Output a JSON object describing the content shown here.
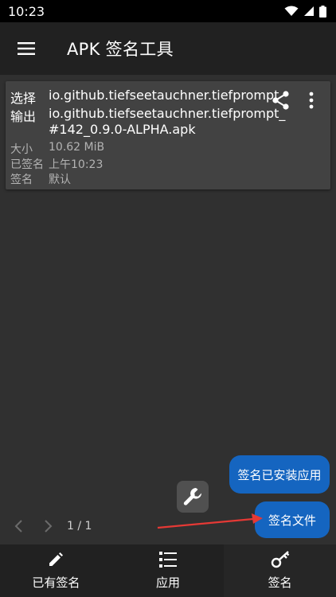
{
  "status_bar": {
    "time": "10:23"
  },
  "app_bar": {
    "title": "APK 签名工具"
  },
  "card": {
    "select_label": "选择",
    "select_value": "io.github.tiefseetauchner.tiefprompt",
    "output_label": "输出",
    "output_value_line1": "io.github.tiefseetauchner.tiefprompt_",
    "output_value_line2": "#142_0.9.0-ALPHA.apk",
    "size_label": "大小",
    "size_value": "10.62 MiB",
    "signed_label": "已签名",
    "signed_value": "上午10:23",
    "signature_label": "签名",
    "signature_value": "默认"
  },
  "fab": {
    "sign_installed": "签名已安装应用",
    "sign_file": "签名文件"
  },
  "pager": {
    "text": "1 / 1"
  },
  "bottom_nav": {
    "items": [
      {
        "label": "已有签名",
        "icon": "pencil-icon"
      },
      {
        "label": "应用",
        "icon": "list-icon"
      },
      {
        "label": "签名",
        "icon": "key-icon"
      }
    ]
  },
  "colors": {
    "accent": "#1565c0",
    "background": "#303030",
    "card": "#424242",
    "bar": "#212121",
    "annotation_arrow": "#e53935"
  }
}
